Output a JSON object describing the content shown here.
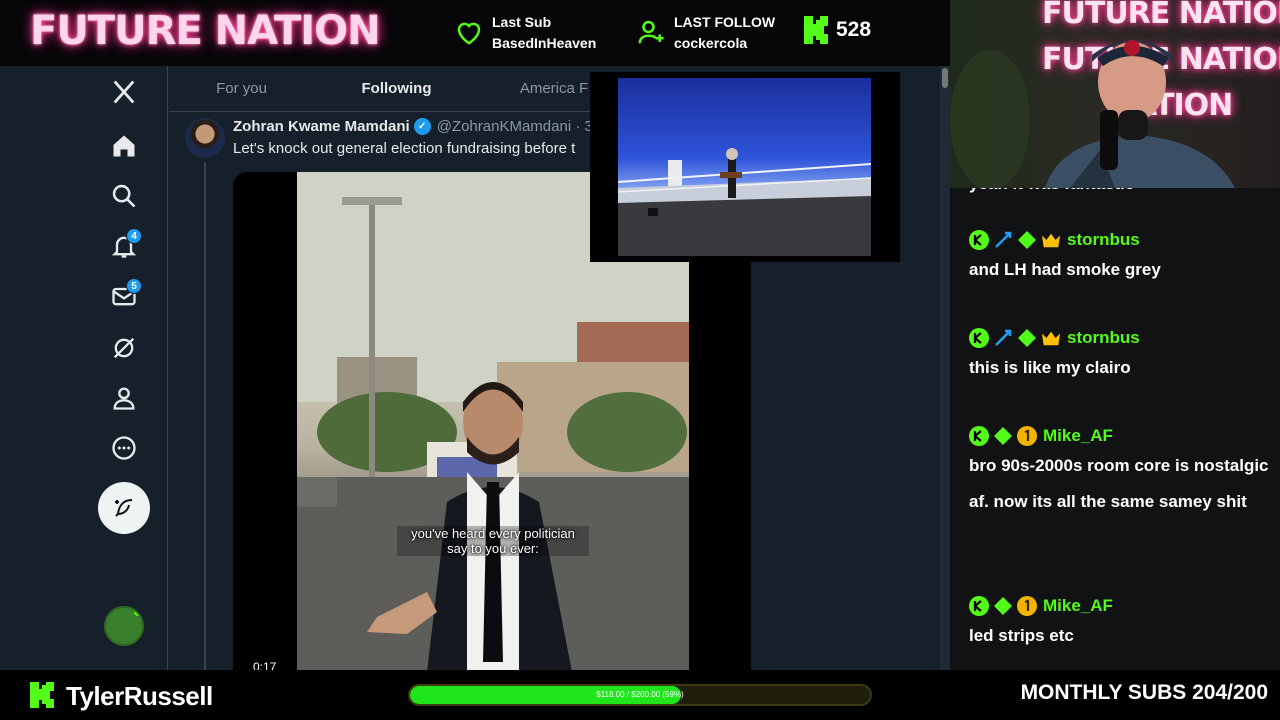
{
  "overlay": {
    "brand": "FUTURE NATION",
    "last_sub_label": "Last Sub",
    "last_sub_value": "BasedInHeaven",
    "last_follow_label": "LAST FOLLOW",
    "last_follow_value": "cockercola",
    "viewer_count": "528",
    "accent": "#53fc18"
  },
  "x_app": {
    "tabs": [
      {
        "label": "For you"
      },
      {
        "label": "Following"
      },
      {
        "label": "America F"
      }
    ],
    "nav_badges": {
      "notifications": "4",
      "messages": "5"
    },
    "tweet": {
      "author": "Zohran Kwame Mamdani",
      "handle": "@ZohranKMamdani · 3",
      "text": "Let's knock out general election fundraising before t",
      "video_caption_line1": "you've heard every politician",
      "video_caption_line2": "say to you ever:",
      "video_time": "0:17"
    }
  },
  "cam": {
    "neon_lines": [
      "FUTURE NATION",
      "FUTURE NATION",
      "NATION"
    ]
  },
  "chat": {
    "partial_top": "yeah it was fantastic",
    "messages": [
      {
        "user": "stornbus",
        "text": "and LH had smoke grey"
      },
      {
        "user": "stornbus",
        "text": "this is like my clairo"
      },
      {
        "user": "Mike_AF",
        "text": "bro 90s-2000s room core is nostalgic af. now its all the same samey shit"
      },
      {
        "user": "Mike_AF",
        "text": "led strips etc"
      }
    ]
  },
  "bottom": {
    "streamer": "TylerRussell",
    "goal_text": "$118.00 / $200.00 (59%)",
    "goal_fraction": 0.59,
    "subs_text": "MONTHLY SUBS 204/200"
  }
}
